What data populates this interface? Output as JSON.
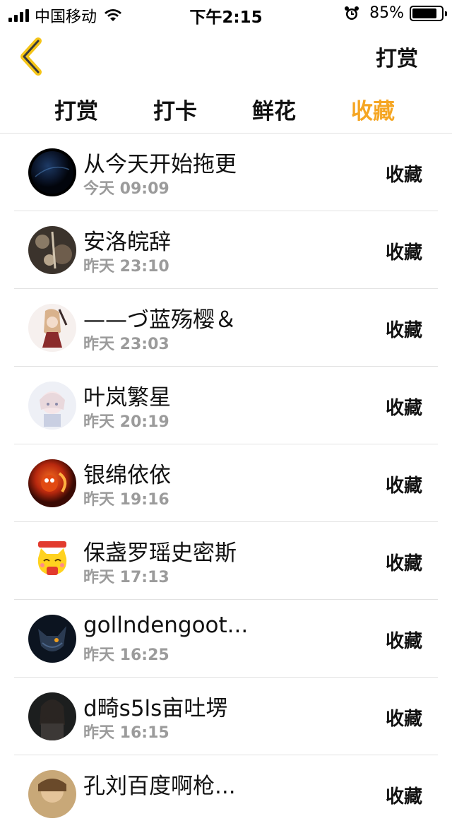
{
  "status_bar": {
    "carrier": "中国移动",
    "time": "下午2:15",
    "battery": "85%",
    "battery_level": 0.85
  },
  "header": {
    "action_label": "打赏"
  },
  "tabs": [
    {
      "label": "打赏",
      "active": false
    },
    {
      "label": "打卡",
      "active": false
    },
    {
      "label": "鲜花",
      "active": false
    },
    {
      "label": "收藏",
      "active": true
    }
  ],
  "colors": {
    "accent": "#f5a623",
    "text": "#111111",
    "secondary_text": "#9b9b9b",
    "divider": "#e2e2e2"
  },
  "list": [
    {
      "name": "从今天开始拖更",
      "time": "今天 09:09",
      "action": "收藏",
      "avatar": "dark-planet-avatar"
    },
    {
      "name": "安洛皖辞",
      "time": "昨天 23:10",
      "action": "收藏",
      "avatar": "portrait-avatar"
    },
    {
      "name": "——づ蓝殇樱＆",
      "time": "昨天 23:03",
      "action": "收藏",
      "avatar": "anime-girl-avatar"
    },
    {
      "name": "叶岚繁星",
      "time": "昨天 20:19",
      "action": "收藏",
      "avatar": "pastel-anime-avatar"
    },
    {
      "name": "银绵依依",
      "time": "昨天 19:16",
      "action": "收藏",
      "avatar": "red-character-avatar"
    },
    {
      "name": "保盏罗瑶史密斯",
      "time": "昨天 17:13",
      "action": "收藏",
      "avatar": "yellow-cat-avatar"
    },
    {
      "name": "gollndengoot...",
      "time": "昨天 16:25",
      "action": "收藏",
      "avatar": "dark-wolf-avatar"
    },
    {
      "name": "d畸s5ls亩吐塄",
      "time": "昨天 16:15",
      "action": "收藏",
      "avatar": "dark-portrait-avatar"
    },
    {
      "name": "孔刘百度啊枪...",
      "time": "",
      "action": "收藏",
      "avatar": "partial-avatar"
    }
  ]
}
